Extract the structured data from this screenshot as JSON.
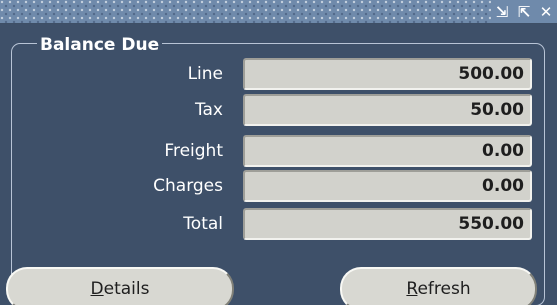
{
  "titlebar": {
    "controls": [
      {
        "icon": "minimize-arrow-icon",
        "glyph": "⇲"
      },
      {
        "icon": "restore-arrow-icon",
        "glyph": "⇱"
      },
      {
        "icon": "close-icon",
        "glyph": "✕"
      }
    ]
  },
  "group": {
    "legend": "Balance Due"
  },
  "rows": [
    {
      "label": "Line",
      "value": "500.00"
    },
    {
      "label": "Tax",
      "value": "50.00"
    },
    {
      "label": "Freight",
      "value": "0.00"
    },
    {
      "label": "Charges",
      "value": "0.00"
    },
    {
      "label": "Total",
      "value": "550.00"
    }
  ],
  "buttons": {
    "details": {
      "mnemonic": "D",
      "rest": "etails"
    },
    "refresh": {
      "mnemonic": "R",
      "rest": "efresh"
    }
  },
  "colors": {
    "panel_background": "#3e5069",
    "field_background": "#d2d2cc",
    "titlebar": "#6f8aab"
  }
}
